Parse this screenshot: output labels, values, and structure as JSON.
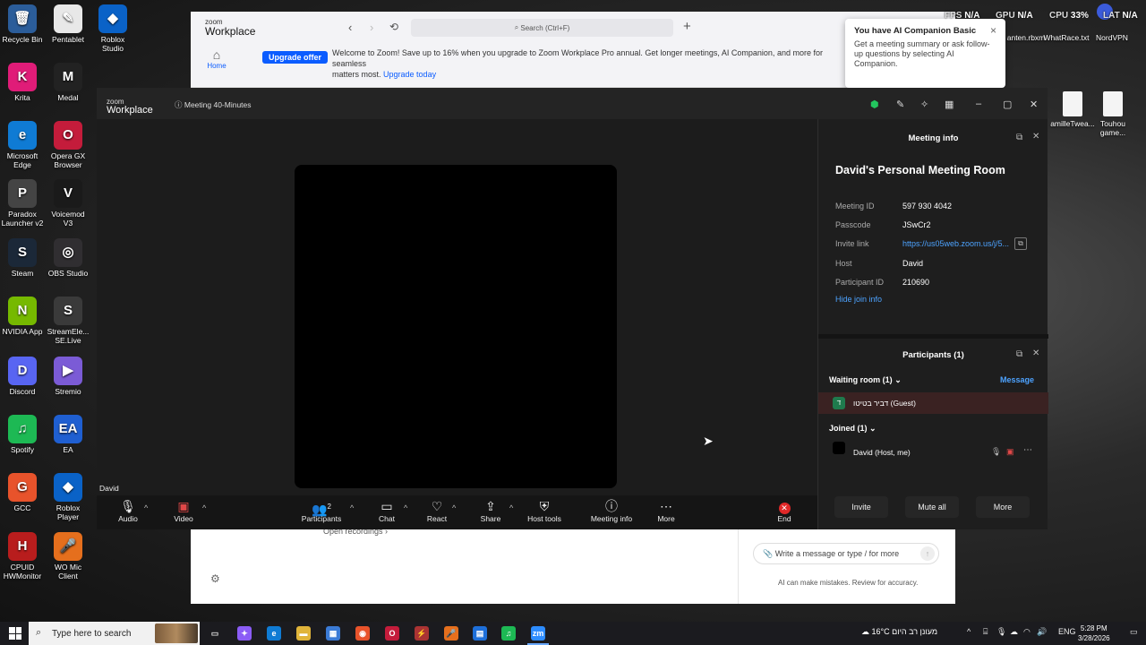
{
  "desktop": {
    "icons": [
      {
        "label": "Recycle Bin",
        "glyph": "🗑",
        "color": "#2b5d9a"
      },
      {
        "label": "Pentablet",
        "glyph": "✎",
        "color": "#e8e8e8"
      },
      {
        "label": "Roblox Studio",
        "glyph": "◆",
        "color": "#0a62c7"
      },
      {
        "label": "Krita",
        "glyph": "K",
        "color": "#e01c78"
      },
      {
        "label": "Medal",
        "glyph": "M",
        "color": "#222"
      },
      {
        "label": "Microsoft Edge",
        "glyph": "e",
        "color": "#0f7bd4"
      },
      {
        "label": "Opera GX Browser",
        "glyph": "O",
        "color": "#c41c3b"
      },
      {
        "label": "Paradox Launcher v2",
        "glyph": "P",
        "color": "#444"
      },
      {
        "label": "Voicemod V3",
        "glyph": "V",
        "color": "#1a1a1a"
      },
      {
        "label": "Steam",
        "glyph": "S",
        "color": "#1b2838"
      },
      {
        "label": "OBS Studio",
        "glyph": "◎",
        "color": "#302e31"
      },
      {
        "label": "NVIDIA App",
        "glyph": "N",
        "color": "#76b900"
      },
      {
        "label": "StreamEle... SE.Live",
        "glyph": "S",
        "color": "#3a3a3a"
      },
      {
        "label": "Discord",
        "glyph": "D",
        "color": "#5865f2"
      },
      {
        "label": "Stremio",
        "glyph": "▶",
        "color": "#7b5bd6"
      },
      {
        "label": "Spotify",
        "glyph": "♫",
        "color": "#1db954"
      },
      {
        "label": "EA",
        "glyph": "EA",
        "color": "#1f5fd1"
      },
      {
        "label": "GCC",
        "glyph": "G",
        "color": "#e8532b"
      },
      {
        "label": "Roblox Player",
        "glyph": "◆",
        "color": "#0a62c7"
      },
      {
        "label": "CPUID HWMonitor",
        "glyph": "H",
        "color": "#b81d1d"
      },
      {
        "label": "WO Mic Client",
        "glyph": "🎤",
        "color": "#e56f1d"
      }
    ],
    "right_files": [
      {
        "label": "anten.rbxm"
      },
      {
        "label": "WhatRace.txt"
      },
      {
        "label": "NordVPN"
      },
      {
        "label": "amilleTwea..."
      },
      {
        "label": "Touhou game..."
      }
    ]
  },
  "overlay_stats": {
    "fps_label": "FPS",
    "fps_value": "N/A",
    "gpu_label": "GPU",
    "gpu_value": "N/A",
    "cpu_label": "CPU",
    "cpu_value": "33%",
    "lat_label": "LAT",
    "lat_value": "N/A"
  },
  "background_window": {
    "logo_small": "zoom",
    "logo_big": "Workplace",
    "search_placeholder": "Search (Ctrl+F)",
    "home_label": "Home",
    "upgrade_badge": "Upgrade offer",
    "welcome_text": "Welcome to Zoom! Save up to 16% when you upgrade to Zoom Workplace Pro annual. Get longer meetings, AI Companion, and more for seamless",
    "welcome_text2": "matters most.",
    "upgrade_link": "Upgrade today",
    "open_recordings": "Open recordings",
    "ai_input_placeholder": "Write a message or type / for more",
    "ai_note": "AI can make mistakes. Review for accuracy."
  },
  "ai_toast": {
    "title": "You have AI Companion Basic",
    "body": "Get a meeting summary or ask follow-up questions by selecting AI Companion."
  },
  "meeting": {
    "logo_small": "zoom",
    "logo_big": "Workplace",
    "timer_label": "Meeting 40-Minutes",
    "participant_name_tag": "David",
    "toolbar": {
      "audio": "Audio",
      "video": "Video",
      "participants": "Participants",
      "participants_count": "2",
      "chat": "Chat",
      "react": "React",
      "share": "Share",
      "host_tools": "Host tools",
      "meeting_info": "Meeting info",
      "more": "More",
      "end": "End"
    },
    "info_panel": {
      "header": "Meeting info",
      "room_title": "David's Personal Meeting Room",
      "rows": [
        {
          "label": "Meeting ID",
          "value": "597 930 4042"
        },
        {
          "label": "Passcode",
          "value": "JSwCr2"
        },
        {
          "label": "Invite link",
          "value": "https://us05web.zoom.us/j/5..."
        },
        {
          "label": "Host",
          "value": "David"
        },
        {
          "label": "Participant ID",
          "value": "210690"
        }
      ],
      "hide_join_info": "Hide join info"
    },
    "participants_panel": {
      "header": "Participants (1)",
      "waiting_room_label": "Waiting room (1)",
      "message_link": "Message",
      "guest_avatar_letter": "ד",
      "guest_name": "דביר בטיטו (Guest)",
      "joined_label": "Joined (1)",
      "host_name": "David (Host, me)",
      "invite_button": "Invite",
      "mute_all_button": "Mute all",
      "more_button": "More"
    }
  },
  "taskbar": {
    "search_placeholder": "Type here to search",
    "weather_temp": "16°C",
    "weather_text": "מעונן רב היום",
    "language": "ENG",
    "time": "5:28 PM",
    "date": "3/28/2026"
  }
}
